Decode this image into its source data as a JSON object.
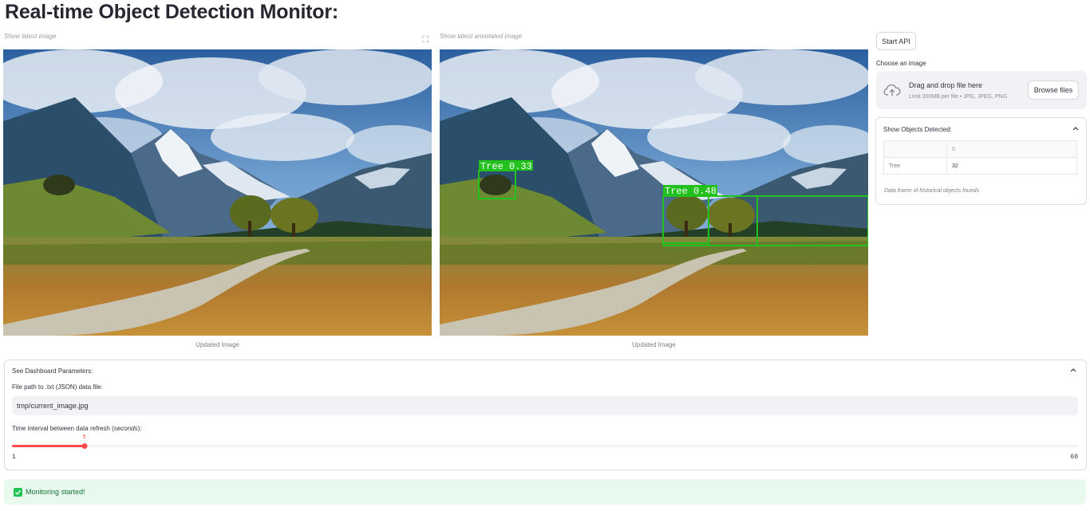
{
  "page": {
    "title": "Real-time Object Detection Monitor:"
  },
  "left_panel": {
    "caption_top": "Show latest image",
    "caption_bottom": "Updated Image"
  },
  "right_image_panel": {
    "caption_top": "Show latest annotated image",
    "caption_bottom": "Updated Image",
    "detections": [
      {
        "label": "Tree 0.33"
      },
      {
        "label": "Tree 0.48"
      }
    ],
    "box_color": "#22c11e"
  },
  "sidebar": {
    "start_button": "Start API",
    "uploader_label": "Choose an image",
    "dropzone_title": "Drag and drop file here",
    "dropzone_limit": "Limit 200MB per file • JPG, JPEG, PNG",
    "browse_button": "Browse files",
    "objects_expander": {
      "title": "Show Objects Detected:",
      "table": {
        "column_header": "0",
        "rows": [
          {
            "index": "Tree",
            "value": "32"
          }
        ]
      },
      "caption": "Data frame of historical objects founds"
    }
  },
  "params_expander": {
    "title": "See Dashboard Parameters:",
    "file_label": "File path to .txt (JSON) data file:",
    "file_value": "tmp/current_image.jpg",
    "interval_label_prefix": "Time interval between data refresh (",
    "interval_label_unit": "seconds",
    "interval_label_suffix": "):",
    "slider": {
      "value": 5,
      "value_label": "5",
      "min": 1,
      "max": 60,
      "min_label": "1",
      "max_label": "60",
      "color": "#ff4b4b"
    }
  },
  "status": {
    "message": "Monitoring started!",
    "icon": "check-icon",
    "color": "#21c354"
  }
}
